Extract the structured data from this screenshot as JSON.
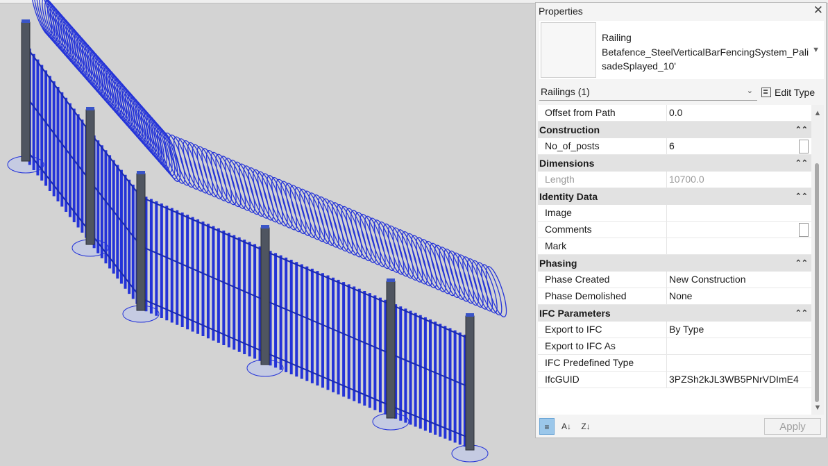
{
  "properties": {
    "title": "Properties",
    "close_icon": "close-icon",
    "type_family": "Railing",
    "type_name": "Betafence_SteelVerticalBarFencingSystem_PalisadeSplayed_10'",
    "filter_label": "Railings (1)",
    "edit_type_label": "Edit Type",
    "apply_label": "Apply",
    "rows": [
      {
        "kind": "prop",
        "label": "Offset from Path",
        "value": "0.0"
      },
      {
        "kind": "group",
        "label": "Construction"
      },
      {
        "kind": "prop",
        "label": "No_of_posts",
        "value": "6",
        "checkbox": true
      },
      {
        "kind": "group",
        "label": "Dimensions"
      },
      {
        "kind": "prop",
        "label": "Length",
        "value": "10700.0",
        "readonly": true
      },
      {
        "kind": "group",
        "label": "Identity Data"
      },
      {
        "kind": "prop",
        "label": "Image",
        "value": ""
      },
      {
        "kind": "prop",
        "label": "Comments",
        "value": "",
        "checkbox": true
      },
      {
        "kind": "prop",
        "label": "Mark",
        "value": ""
      },
      {
        "kind": "group",
        "label": "Phasing"
      },
      {
        "kind": "prop",
        "label": "Phase Created",
        "value": "New Construction"
      },
      {
        "kind": "prop",
        "label": "Phase Demolished",
        "value": "None"
      },
      {
        "kind": "group",
        "label": "IFC Parameters"
      },
      {
        "kind": "prop",
        "label": "Export to IFC",
        "value": "By Type"
      },
      {
        "kind": "prop",
        "label": "Export to IFC As",
        "value": ""
      },
      {
        "kind": "prop",
        "label": "IFC Predefined Type",
        "value": ""
      },
      {
        "kind": "prop",
        "label": "IfcGUID",
        "value": "3PZSh2kJL3WB5PNrVDImE4"
      }
    ]
  },
  "viewport": {
    "fence_color": "#2433d8",
    "post_color": "#4f5560",
    "background": "#d3d3d3"
  }
}
